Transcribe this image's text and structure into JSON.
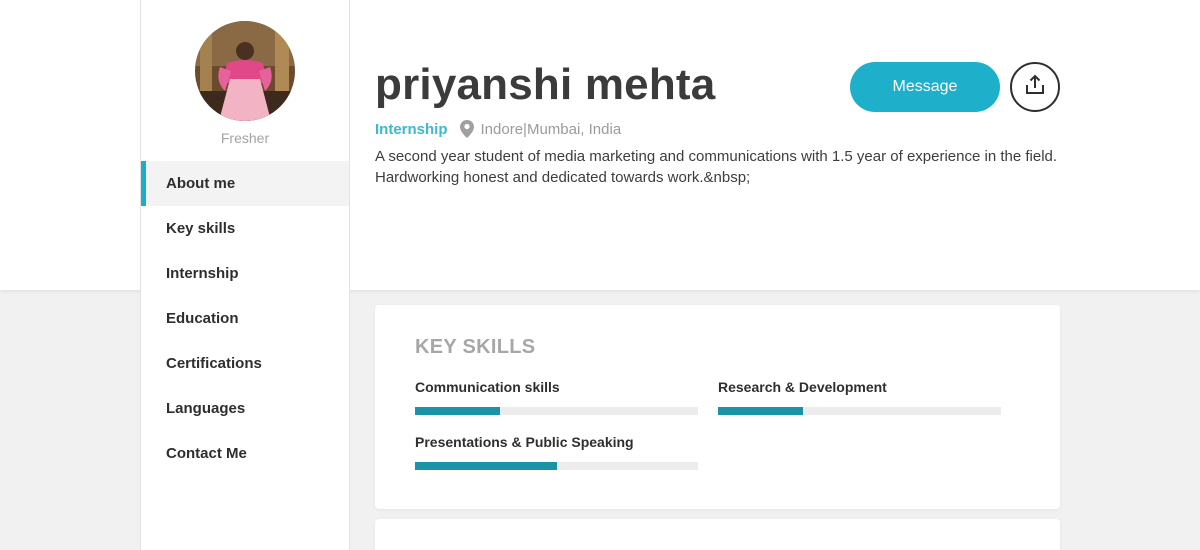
{
  "sidebar": {
    "status": "Fresher",
    "nav": [
      {
        "label": "About me",
        "active": true
      },
      {
        "label": "Key skills"
      },
      {
        "label": "Internship"
      },
      {
        "label": "Education"
      },
      {
        "label": "Certifications"
      },
      {
        "label": "Languages"
      },
      {
        "label": "Contact Me"
      }
    ]
  },
  "profile": {
    "name": "priyanshi mehta",
    "type": "Internship",
    "location": "Indore|Mumbai, India",
    "about": "A second year student of media marketing and communications with 1.5 year of experience in the field. Hardworking honest and dedicated towards work.&nbsp;",
    "message_label": "Message",
    "share_icon": "share-upload-icon",
    "location_icon": "map-pin-icon"
  },
  "key_skills": {
    "title": "KEY SKILLS",
    "skills": [
      {
        "name": "Communication skills",
        "level": 0.3
      },
      {
        "name": "Research & Development",
        "level": 0.3
      },
      {
        "name": "Presentations & Public Speaking",
        "level": 0.5
      }
    ]
  },
  "colors": {
    "accent": "#1eb0ca",
    "skill_bar": "#1b93a6",
    "skill_track": "#ececec"
  }
}
